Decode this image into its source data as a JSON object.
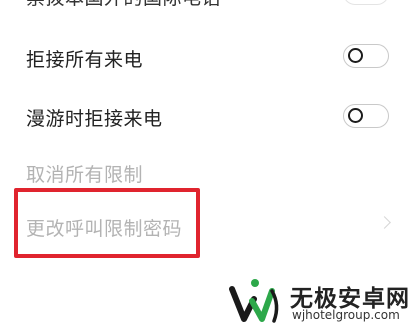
{
  "settings": {
    "items": [
      {
        "label": "禁拨本国外的国际电话",
        "type": "toggle",
        "checked": false
      },
      {
        "label": "拒接所有来电",
        "type": "toggle",
        "checked": false
      },
      {
        "label": "漫游时拒接来电",
        "type": "toggle",
        "checked": false
      },
      {
        "label": "取消所有限制",
        "type": "action",
        "enabled": false
      },
      {
        "label": "更改呼叫限制密码",
        "type": "link",
        "enabled": false
      }
    ]
  },
  "annotation": {
    "color": "#e0242e",
    "target": "更改呼叫限制密码"
  },
  "watermark": {
    "title": "无极安卓网",
    "url": "wjhotelgroup.com",
    "logo": "wj-logo-icon"
  }
}
